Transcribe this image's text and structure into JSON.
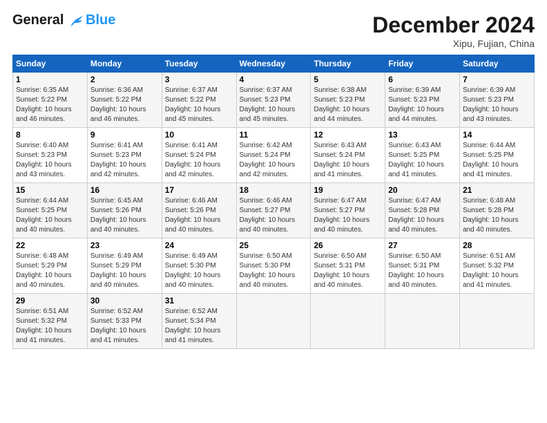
{
  "header": {
    "logo_line1": "General",
    "logo_line2": "Blue",
    "month_title": "December 2024",
    "location": "Xipu, Fujian, China"
  },
  "calendar": {
    "days_of_week": [
      "Sunday",
      "Monday",
      "Tuesday",
      "Wednesday",
      "Thursday",
      "Friday",
      "Saturday"
    ],
    "weeks": [
      [
        {
          "num": "",
          "info": ""
        },
        {
          "num": "2",
          "info": "Sunrise: 6:36 AM\nSunset: 5:22 PM\nDaylight: 10 hours\nand 46 minutes."
        },
        {
          "num": "3",
          "info": "Sunrise: 6:37 AM\nSunset: 5:22 PM\nDaylight: 10 hours\nand 45 minutes."
        },
        {
          "num": "4",
          "info": "Sunrise: 6:37 AM\nSunset: 5:23 PM\nDaylight: 10 hours\nand 45 minutes."
        },
        {
          "num": "5",
          "info": "Sunrise: 6:38 AM\nSunset: 5:23 PM\nDaylight: 10 hours\nand 44 minutes."
        },
        {
          "num": "6",
          "info": "Sunrise: 6:39 AM\nSunset: 5:23 PM\nDaylight: 10 hours\nand 44 minutes."
        },
        {
          "num": "7",
          "info": "Sunrise: 6:39 AM\nSunset: 5:23 PM\nDaylight: 10 hours\nand 43 minutes."
        }
      ],
      [
        {
          "num": "1",
          "info": "Sunrise: 6:35 AM\nSunset: 5:22 PM\nDaylight: 10 hours\nand 46 minutes."
        },
        {
          "num": "8",
          "info": ""
        },
        {
          "num": "9",
          "info": ""
        },
        {
          "num": "10",
          "info": ""
        },
        {
          "num": "11",
          "info": ""
        },
        {
          "num": "12",
          "info": ""
        },
        {
          "num": "13",
          "info": ""
        }
      ],
      [
        {
          "num": "8",
          "info": "Sunrise: 6:40 AM\nSunset: 5:23 PM\nDaylight: 10 hours\nand 43 minutes."
        },
        {
          "num": "9",
          "info": "Sunrise: 6:41 AM\nSunset: 5:23 PM\nDaylight: 10 hours\nand 42 minutes."
        },
        {
          "num": "10",
          "info": "Sunrise: 6:41 AM\nSunset: 5:24 PM\nDaylight: 10 hours\nand 42 minutes."
        },
        {
          "num": "11",
          "info": "Sunrise: 6:42 AM\nSunset: 5:24 PM\nDaylight: 10 hours\nand 42 minutes."
        },
        {
          "num": "12",
          "info": "Sunrise: 6:43 AM\nSunset: 5:24 PM\nDaylight: 10 hours\nand 41 minutes."
        },
        {
          "num": "13",
          "info": "Sunrise: 6:43 AM\nSunset: 5:25 PM\nDaylight: 10 hours\nand 41 minutes."
        },
        {
          "num": "14",
          "info": "Sunrise: 6:44 AM\nSunset: 5:25 PM\nDaylight: 10 hours\nand 41 minutes."
        }
      ],
      [
        {
          "num": "15",
          "info": "Sunrise: 6:44 AM\nSunset: 5:25 PM\nDaylight: 10 hours\nand 40 minutes."
        },
        {
          "num": "16",
          "info": "Sunrise: 6:45 AM\nSunset: 5:26 PM\nDaylight: 10 hours\nand 40 minutes."
        },
        {
          "num": "17",
          "info": "Sunrise: 6:46 AM\nSunset: 5:26 PM\nDaylight: 10 hours\nand 40 minutes."
        },
        {
          "num": "18",
          "info": "Sunrise: 6:46 AM\nSunset: 5:27 PM\nDaylight: 10 hours\nand 40 minutes."
        },
        {
          "num": "19",
          "info": "Sunrise: 6:47 AM\nSunset: 5:27 PM\nDaylight: 10 hours\nand 40 minutes."
        },
        {
          "num": "20",
          "info": "Sunrise: 6:47 AM\nSunset: 5:28 PM\nDaylight: 10 hours\nand 40 minutes."
        },
        {
          "num": "21",
          "info": "Sunrise: 6:48 AM\nSunset: 5:28 PM\nDaylight: 10 hours\nand 40 minutes."
        }
      ],
      [
        {
          "num": "22",
          "info": "Sunrise: 6:48 AM\nSunset: 5:29 PM\nDaylight: 10 hours\nand 40 minutes."
        },
        {
          "num": "23",
          "info": "Sunrise: 6:49 AM\nSunset: 5:29 PM\nDaylight: 10 hours\nand 40 minutes."
        },
        {
          "num": "24",
          "info": "Sunrise: 6:49 AM\nSunset: 5:30 PM\nDaylight: 10 hours\nand 40 minutes."
        },
        {
          "num": "25",
          "info": "Sunrise: 6:50 AM\nSunset: 5:30 PM\nDaylight: 10 hours\nand 40 minutes."
        },
        {
          "num": "26",
          "info": "Sunrise: 6:50 AM\nSunset: 5:31 PM\nDaylight: 10 hours\nand 40 minutes."
        },
        {
          "num": "27",
          "info": "Sunrise: 6:50 AM\nSunset: 5:31 PM\nDaylight: 10 hours\nand 40 minutes."
        },
        {
          "num": "28",
          "info": "Sunrise: 6:51 AM\nSunset: 5:32 PM\nDaylight: 10 hours\nand 41 minutes."
        }
      ],
      [
        {
          "num": "29",
          "info": "Sunrise: 6:51 AM\nSunset: 5:32 PM\nDaylight: 10 hours\nand 41 minutes."
        },
        {
          "num": "30",
          "info": "Sunrise: 6:52 AM\nSunset: 5:33 PM\nDaylight: 10 hours\nand 41 minutes."
        },
        {
          "num": "31",
          "info": "Sunrise: 6:52 AM\nSunset: 5:34 PM\nDaylight: 10 hours\nand 41 minutes."
        },
        {
          "num": "",
          "info": ""
        },
        {
          "num": "",
          "info": ""
        },
        {
          "num": "",
          "info": ""
        },
        {
          "num": "",
          "info": ""
        }
      ]
    ]
  }
}
